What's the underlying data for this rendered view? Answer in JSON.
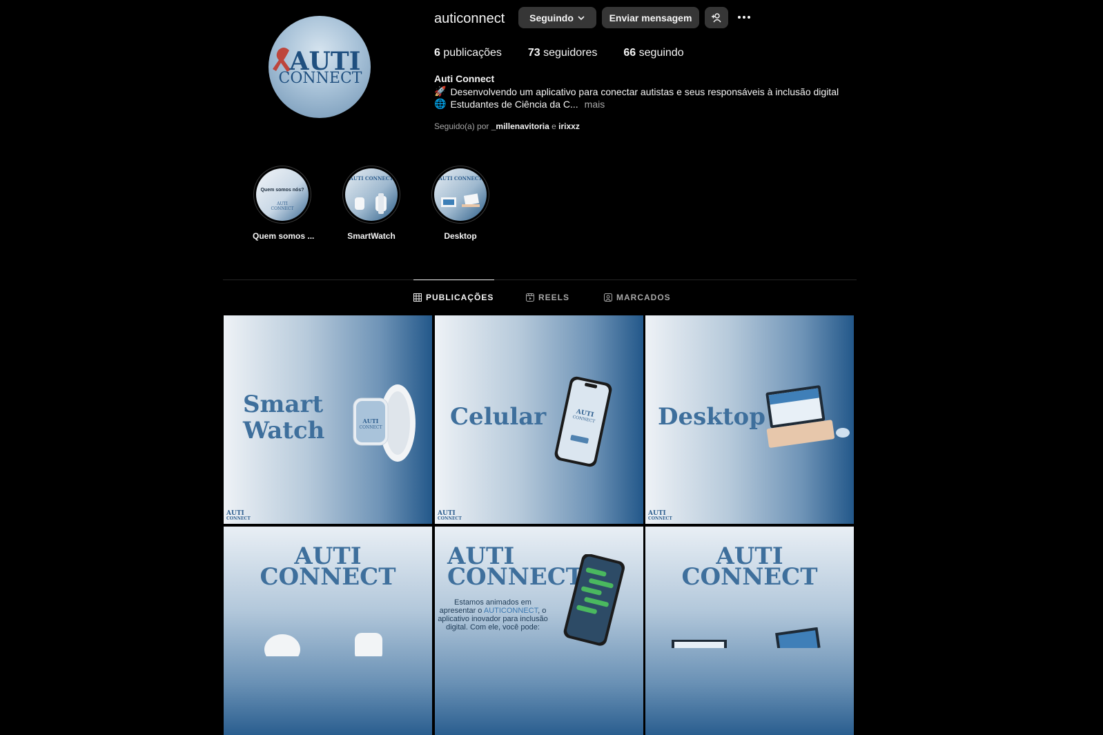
{
  "profile": {
    "username": "auticonnect",
    "avatar_logo_top": "AUTI",
    "avatar_logo_bottom": "CONNECT",
    "follow_button": "Seguindo",
    "message_button": "Enviar mensagem",
    "add_user_icon": "add-user-icon",
    "more_icon": "more-options-icon"
  },
  "stats": {
    "posts_count": "6",
    "posts_label": "publicações",
    "followers_count": "73",
    "followers_label": "seguidores",
    "following_count": "66",
    "following_label": "seguindo"
  },
  "bio": {
    "name": "Auti Connect",
    "line1_emoji": "🚀",
    "line1": "Desenvolvendo um aplicativo para conectar autistas e seus responsáveis à inclusão digital",
    "line2_emoji": "🌐",
    "line2": "Estudantes de Ciência da C...",
    "more": "mais"
  },
  "followed_by": {
    "prefix": "Seguido(a) por",
    "user1": "_millenavitoria",
    "connector": "e",
    "user2": "irixxz"
  },
  "highlights": [
    {
      "label": "Quem somos ...",
      "inner_text": "Quem somos nós?"
    },
    {
      "label": "SmartWatch",
      "inner_text": "AUTI CONNECT"
    },
    {
      "label": "Desktop",
      "inner_text": "AUTI CONNECT"
    }
  ],
  "tabs": [
    {
      "label": "PUBLICAÇÕES",
      "icon": "grid-icon",
      "active": true
    },
    {
      "label": "REELS",
      "icon": "reels-icon",
      "active": false
    },
    {
      "label": "MARCADOS",
      "icon": "tagged-icon",
      "active": false
    }
  ],
  "posts": [
    {
      "title_line1": "Smart",
      "title_line2": "Watch"
    },
    {
      "title_line1": "Celular",
      "title_line2": ""
    },
    {
      "title_line1": "Desktop",
      "title_line2": ""
    },
    {
      "logo_top": "AUTI",
      "logo_bottom": "CONNECT"
    },
    {
      "logo_top": "AUTI",
      "logo_bottom": "CONNECT",
      "caption_before": "Estamos animados em apresentar o",
      "caption_brand": "AUTICONNECT",
      "caption_after": ", o aplicativo inovador para inclusão digital. Com ele, você pode:"
    },
    {
      "logo_top": "AUTI",
      "logo_bottom": "CONNECT"
    }
  ],
  "mini_logo": {
    "top": "AUTI",
    "bottom": "CONNECT"
  },
  "colors": {
    "background": "#000000",
    "button": "#363636",
    "brand_blue": "#3e6f9c",
    "muted": "#a8a8a8"
  }
}
